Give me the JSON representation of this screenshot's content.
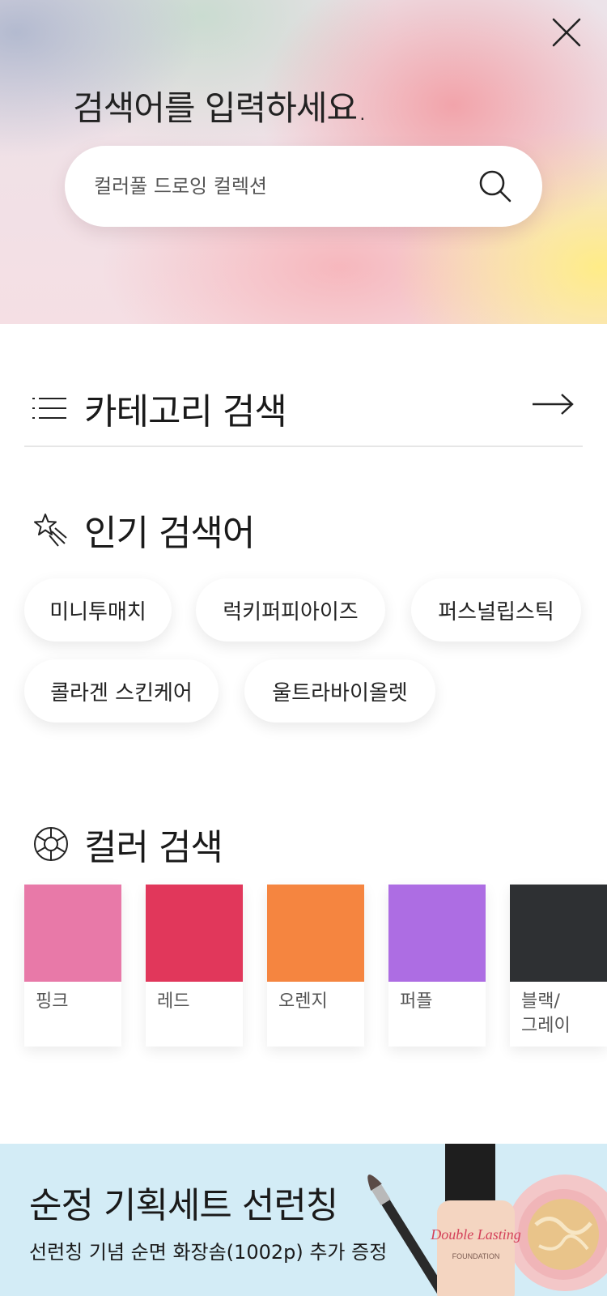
{
  "hero": {
    "title": "검색어를 입력하세요.",
    "search_placeholder": "컬러풀 드로잉 컬렉션"
  },
  "category": {
    "title": "카테고리 검색"
  },
  "popular": {
    "title": "인기 검색어",
    "keywords": [
      "미니투매치",
      "럭키퍼피아이즈",
      "퍼스널립스틱",
      "콜라겐 스킨케어",
      "울트라바이올렛"
    ]
  },
  "colors": {
    "title": "컬러 검색",
    "items": [
      {
        "label": "핑크",
        "hex": "#e879a8"
      },
      {
        "label": "레드",
        "hex": "#e1375b"
      },
      {
        "label": "오렌지",
        "hex": "#f58540"
      },
      {
        "label": "퍼플",
        "hex": "#ad6de3"
      },
      {
        "label": "블랙/\n그레이",
        "hex": "#2e3033"
      }
    ]
  },
  "banner": {
    "title": "순정 기획세트 선런칭",
    "subtitle": "선런칭 기념 순면 화장솜(1002p) 추가 증정",
    "product_text": "Double Lasting",
    "product_subtext": "FOUNDATION",
    "bg_color": "#d3ecf6"
  },
  "icons": {
    "close": "close-icon",
    "search": "search-icon",
    "category": "list-menu-icon",
    "category_arrow": "arrow-right-icon",
    "popular": "shooting-star-icon",
    "colors": "color-wheel-icon"
  }
}
